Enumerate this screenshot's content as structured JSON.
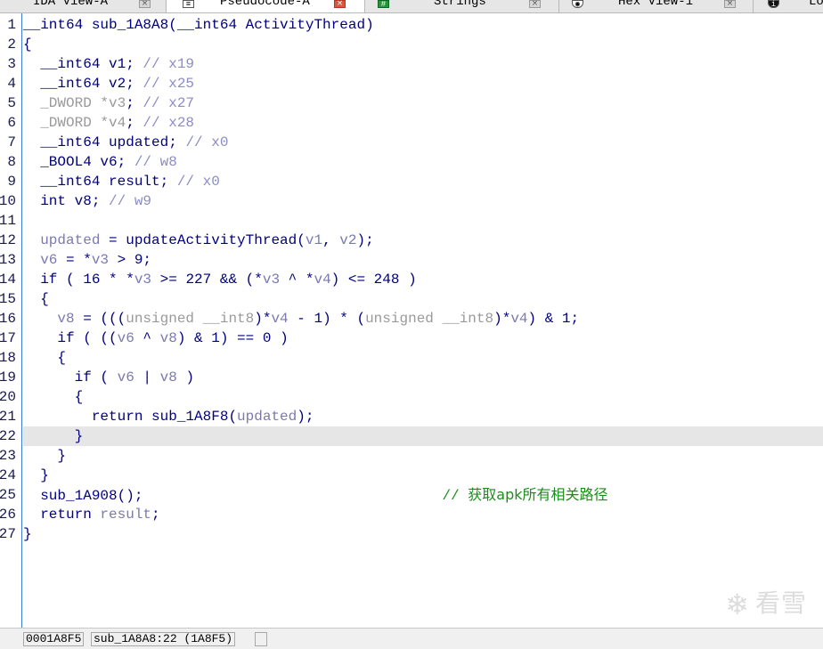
{
  "tabs": [
    {
      "label": "IDA View-A",
      "icon": "none",
      "active": false
    },
    {
      "label": "Pseudocode-A",
      "icon": "document-icon",
      "active": true
    },
    {
      "label": "Strings",
      "icon": "strings-icon",
      "active": false
    },
    {
      "label": "Hex View-1",
      "icon": "hex-icon",
      "active": false
    },
    {
      "label": "Lo",
      "icon": "info-icon",
      "active": false
    }
  ],
  "close_glyph": "×",
  "line_numbers": [
    "1",
    "2",
    "3",
    "4",
    "5",
    "6",
    "7",
    "8",
    "9",
    "10",
    "11",
    "12",
    "13",
    "14",
    "15",
    "16",
    "17",
    "18",
    "19",
    "20",
    "21",
    "22",
    "23",
    "24",
    "25",
    "26",
    "27"
  ],
  "code": {
    "l1": {
      "a": "__int64 sub_1A8A8(__int64 ActivityThread)"
    },
    "l2": {
      "a": "{"
    },
    "l3": {
      "a": "  __int64 v1; ",
      "c": "// x19"
    },
    "l4": {
      "a": "  __int64 v2; ",
      "c": "// x25"
    },
    "l5": {
      "g": "  _DWORD *v3",
      "a": "; ",
      "c": "// x27"
    },
    "l6": {
      "g": "  _DWORD *v4",
      "a": "; ",
      "c": "// x28"
    },
    "l7": {
      "a": "  __int64 updated; ",
      "c": "// x0"
    },
    "l8": {
      "a": "  _BOOL4 v6; ",
      "c": "// w8"
    },
    "l9": {
      "a": "  __int64 result; ",
      "c": "// x0"
    },
    "l10": {
      "a": "  int v8; ",
      "c": "// w9"
    },
    "l11": {
      "a": ""
    },
    "l12": {
      "p1": "  ",
      "v1": "updated",
      "p2": " = updateActivityThread(",
      "v2": "v1",
      "p3": ", ",
      "v3": "v2",
      "p4": ");"
    },
    "l13": {
      "p1": "  ",
      "v1": "v6",
      "p2": " = *",
      "v2": "v3",
      "p3": " > 9;"
    },
    "l14": {
      "p1": "  if ( 16 * *",
      "v1": "v3",
      "p2": " >= 227 && (*",
      "v2": "v3",
      "p3": " ^ *",
      "v3": "v4",
      "p4": ") <= 248 )"
    },
    "l15": {
      "a": "  {"
    },
    "l16": {
      "p1": "    ",
      "v1": "v8",
      "p2": " = (((",
      "g1": "unsigned __int8",
      "p3": ")*",
      "v2": "v4",
      "p4": " - 1) * (",
      "g2": "unsigned __int8",
      "p5": ")*",
      "v3": "v4",
      "p6": ") & 1;"
    },
    "l17": {
      "p1": "    if ( ((",
      "v1": "v6",
      "p2": " ^ ",
      "v2": "v8",
      "p3": ") & 1) == 0 )"
    },
    "l18": {
      "a": "    {"
    },
    "l19": {
      "p1": "      if ( ",
      "v1": "v6",
      "p2": " | ",
      "v2": "v8",
      "p3": " )"
    },
    "l20": {
      "a": "      {"
    },
    "l21": {
      "p1": "        return sub_1A8F8(",
      "v1": "updated",
      "p2": ");"
    },
    "l22": {
      "a": "      }"
    },
    "l23": {
      "a": "    }"
    },
    "l24": {
      "a": "  }"
    },
    "l25": {
      "a": "  sub_1A908();",
      "pad": "                                   ",
      "c1": "// ",
      "c2": "获取apk所有相关路径"
    },
    "l26": {
      "p1": "  return ",
      "v1": "result",
      "p2": ";"
    },
    "l27": {
      "a": "}"
    }
  },
  "status": {
    "address": "0001A8F5",
    "location": "sub_1A8A8:22 (1A8F5)"
  },
  "watermark": {
    "icon": "snowflake-icon",
    "glyph": "❄",
    "text": "看雪"
  }
}
